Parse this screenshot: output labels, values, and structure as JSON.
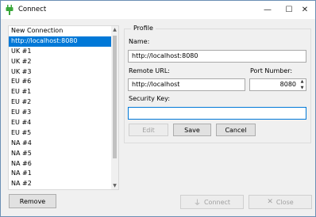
{
  "window": {
    "title": "Connect",
    "minimize_glyph": "—",
    "maximize_glyph": "☐",
    "close_glyph": "✕"
  },
  "connections": {
    "items": [
      "New Connection",
      "http://localhost:8080",
      "UK #1",
      "UK #2",
      "UK #3",
      "EU #6",
      "EU #1",
      "EU #2",
      "EU #3",
      "EU #4",
      "EU #5",
      "NA #4",
      "NA #5",
      "NA #6",
      "NA #1",
      "NA #2"
    ],
    "selected_index": 1,
    "remove_label": "Remove"
  },
  "profile": {
    "group_label": "Profile",
    "name_label": "Name:",
    "name_value": "http://localhost:8080",
    "remote_url_label": "Remote URL:",
    "remote_url_value": "http://localhost",
    "port_label": "Port Number:",
    "port_value": "8080",
    "security_key_label": "Security Key:",
    "security_key_value": "",
    "edit_label": "Edit",
    "save_label": "Save",
    "cancel_label": "Cancel"
  },
  "footer": {
    "connect_label": "Connect",
    "close_label": "Close"
  },
  "icons": {
    "app": "plug-icon",
    "connect": "plug-icon",
    "close": "x-icon"
  },
  "colors": {
    "selection": "#0078d7",
    "focus_border": "#0078d7",
    "app_icon": "#3aa83a"
  }
}
